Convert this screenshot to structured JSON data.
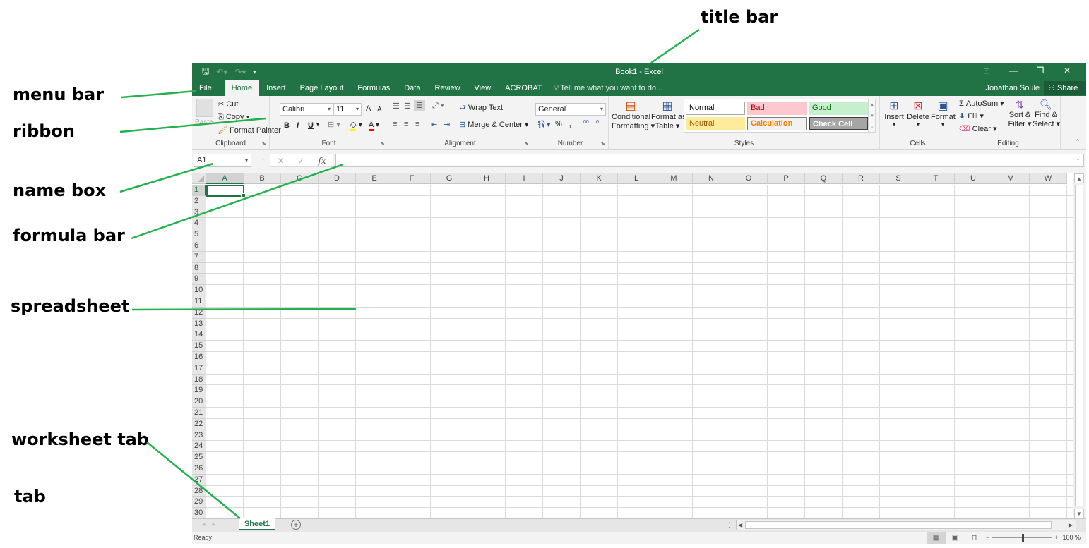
{
  "annotations": {
    "title_bar": "title bar",
    "menu_bar": "menu bar",
    "ribbon": "ribbon",
    "name_box": "name box",
    "formula_bar": "formula bar",
    "spreadsheet": "spreadsheet",
    "worksheet_tab": "worksheet tab",
    "tab": "tab",
    "line_color": "#22b14c"
  },
  "window": {
    "title": "Book1 - Excel",
    "accent": "#217346",
    "quick_access": {
      "save": "save-icon",
      "undo": "undo-icon",
      "redo": "redo-icon",
      "customize": "customize-icon"
    },
    "controls": {
      "ribbon_display": "ribbon-display-icon",
      "minimize": "minimize-icon",
      "restore": "restore-icon",
      "close": "close-icon"
    }
  },
  "menu": {
    "items": [
      "File",
      "Home",
      "Insert",
      "Page Layout",
      "Formulas",
      "Data",
      "Review",
      "View",
      "ACROBAT"
    ],
    "active": "Home",
    "tell_me": "Tell me what you want to do...",
    "user": "Jonathan Soule",
    "share": "Share"
  },
  "ribbon": {
    "clipboard": {
      "paste": "Paste",
      "cut": "Cut",
      "copy": "Copy",
      "format_painter": "Format Painter",
      "label": "Clipboard"
    },
    "font": {
      "family": "Calibri",
      "size": "11",
      "bold": "B",
      "italic": "I",
      "underline": "U",
      "grow": "A",
      "shrink": "A",
      "fill_color": "#ffff00",
      "font_color": "#ff0000",
      "label": "Font"
    },
    "alignment": {
      "wrap_text": "Wrap Text",
      "merge_center": "Merge & Center",
      "label": "Alignment"
    },
    "number": {
      "format": "General",
      "percent": "%",
      "comma": ",",
      "inc_decimal": ".00",
      "dec_decimal": ".0",
      "label": "Number"
    },
    "styles": {
      "conditional_formatting": [
        "Conditional",
        "Formatting"
      ],
      "format_as_table": [
        "Format as",
        "Table"
      ],
      "cells": [
        {
          "name": "Normal",
          "bg": "#ffffff",
          "fg": "#000000",
          "border": "#a6a6a6"
        },
        {
          "name": "Bad",
          "bg": "#ffc7ce",
          "fg": "#9c0006",
          "border": "#ffc7ce"
        },
        {
          "name": "Good",
          "bg": "#c6efce",
          "fg": "#006100",
          "border": "#c6efce"
        },
        {
          "name": "Neutral",
          "bg": "#ffeb9c",
          "fg": "#9c5700",
          "border": "#ffeb9c"
        },
        {
          "name": "Calculation",
          "bg": "#f2f2f2",
          "fg": "#fa7d00",
          "border": "#7f7f7f"
        },
        {
          "name": "Check Cell",
          "bg": "#a5a5a5",
          "fg": "#ffffff",
          "border": "#3f3f3f"
        }
      ],
      "label": "Styles"
    },
    "cells": {
      "insert": "Insert",
      "delete": "Delete",
      "format": "Format",
      "label": "Cells"
    },
    "editing": {
      "autosum": "AutoSum",
      "fill": "Fill",
      "clear": "Clear",
      "sort_filter": [
        "Sort &",
        "Filter"
      ],
      "find_select": [
        "Find &",
        "Select"
      ],
      "label": "Editing"
    }
  },
  "formula_bar": {
    "name_box": "A1",
    "cancel": "✕",
    "enter": "✓",
    "fx": "fx",
    "value": ""
  },
  "sheet": {
    "columns": [
      "A",
      "B",
      "C",
      "D",
      "E",
      "F",
      "G",
      "H",
      "I",
      "J",
      "K",
      "L",
      "M",
      "N",
      "O",
      "P",
      "Q",
      "R",
      "S",
      "T",
      "U",
      "V",
      "W"
    ],
    "row_count": 30,
    "selected_cell": "A1"
  },
  "tabs": {
    "sheets": [
      "Sheet1"
    ],
    "active": "Sheet1",
    "add": "+"
  },
  "status": {
    "text": "Ready",
    "zoom": "100 %",
    "zoom_level": 100,
    "views": [
      "normal-view-icon",
      "page-layout-view-icon",
      "page-break-view-icon"
    ]
  }
}
